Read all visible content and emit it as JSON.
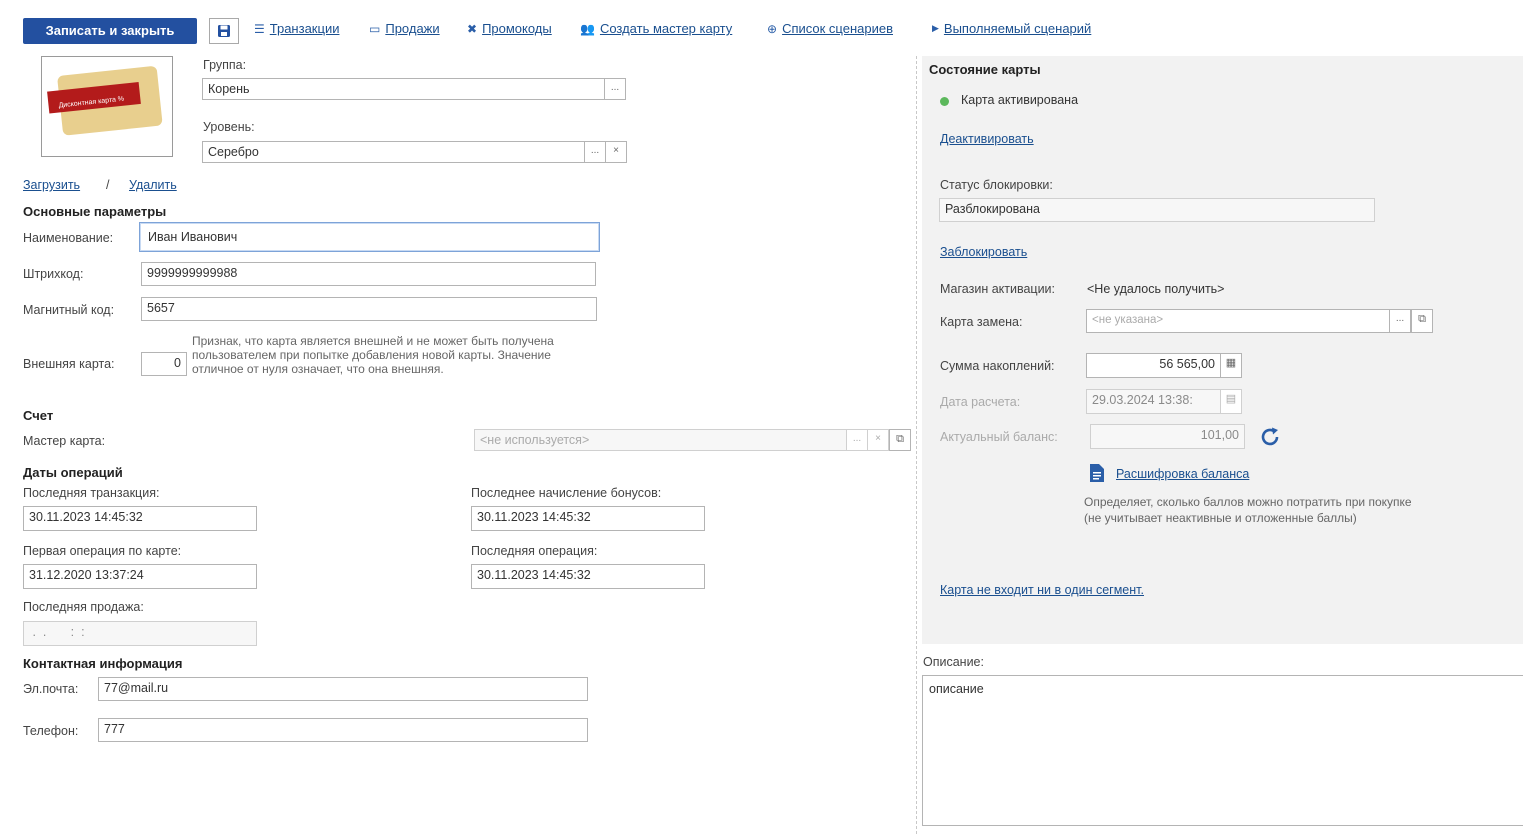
{
  "toolbar": {
    "save_close": "Записать и закрыть",
    "links": [
      {
        "label": "Транзакции",
        "icon": "list-icon"
      },
      {
        "label": "Продажи",
        "icon": "cash-icon"
      },
      {
        "label": "Промокоды",
        "icon": "coupon-icon"
      },
      {
        "label": "Создать мастер карту",
        "icon": "users-icon"
      },
      {
        "label": "Список сценариев",
        "icon": "add-circle-icon"
      },
      {
        "label": "Выполняемый сценарий",
        "icon": "play-icon"
      }
    ]
  },
  "card": {
    "image_text": "Дисконтная карта %",
    "group_label": "Группа:",
    "group_value": "Корень",
    "level_label": "Уровень:",
    "level_value": "Серебро",
    "load": "Загрузить",
    "sep": "/",
    "delete": "Удалить"
  },
  "main": {
    "title": "Основные параметры",
    "name_label": "Наименование:",
    "name_value": "Иван Иванович",
    "barcode_label": "Штрихкод:",
    "barcode_value": "9999999999988",
    "magnet_label": "Магнитный код:",
    "magnet_value": "5657",
    "external_label": "Внешняя карта:",
    "external_value": "0",
    "external_hint": "Признак, что карта является внешней и не может быть получена пользователем при попытке добавления новой карты. Значение отличное от нуля означает, что она внешняя."
  },
  "account": {
    "title": "Счет",
    "master_label": "Мастер карта:",
    "master_placeholder": "<не используется>"
  },
  "dates": {
    "title": "Даты операций",
    "last_tx_label": "Последняя транзакция:",
    "last_tx_value": "30.11.2023 14:45:32",
    "last_bonus_label": "Последнее начисление бонусов:",
    "last_bonus_value": "30.11.2023 14:45:32",
    "first_op_label": "Первая операция по карте:",
    "first_op_value": "31.12.2020 13:37:24",
    "last_op_label": "Последняя операция:",
    "last_op_value": "30.11.2023 14:45:32",
    "last_sale_label": "Последняя продажа:",
    "last_sale_value": " .  .       :  :"
  },
  "contact": {
    "title": "Контактная информация",
    "email_label": "Эл.почта:",
    "email_value": "77@mail.ru",
    "phone_label": "Телефон:",
    "phone_value": "777"
  },
  "state": {
    "title": "Состояние карты",
    "status": "Карта активирована",
    "status_color": "#5cb85c",
    "deactivate": "Деактивировать",
    "block_status_label": "Статус блокировки:",
    "block_status_value": "Разблокирована",
    "block": "Заблокировать",
    "shop_label": "Магазин активации:",
    "shop_value": "<Не удалось получить>",
    "replace_label": "Карта замена:",
    "replace_placeholder": "<не указана>",
    "sum_label": "Сумма накоплений:",
    "sum_value": "56 565,00",
    "calc_date_label": "Дата расчета:",
    "calc_date_value": "29.03.2024 13:38:",
    "balance_label": "Актуальный баланс:",
    "balance_value": "101,00",
    "balance_detail": "Расшифровка баланса",
    "balance_hint": "Определяет, сколько баллов можно потратить при покупке (не учитывает неактивные и отложенные баллы)",
    "segment": "Карта не входит ни в один сегмент."
  },
  "description": {
    "label": "Описание:",
    "value": "описание"
  },
  "colors": {
    "primary": "#2350a0",
    "link": "#1a4f8f"
  }
}
